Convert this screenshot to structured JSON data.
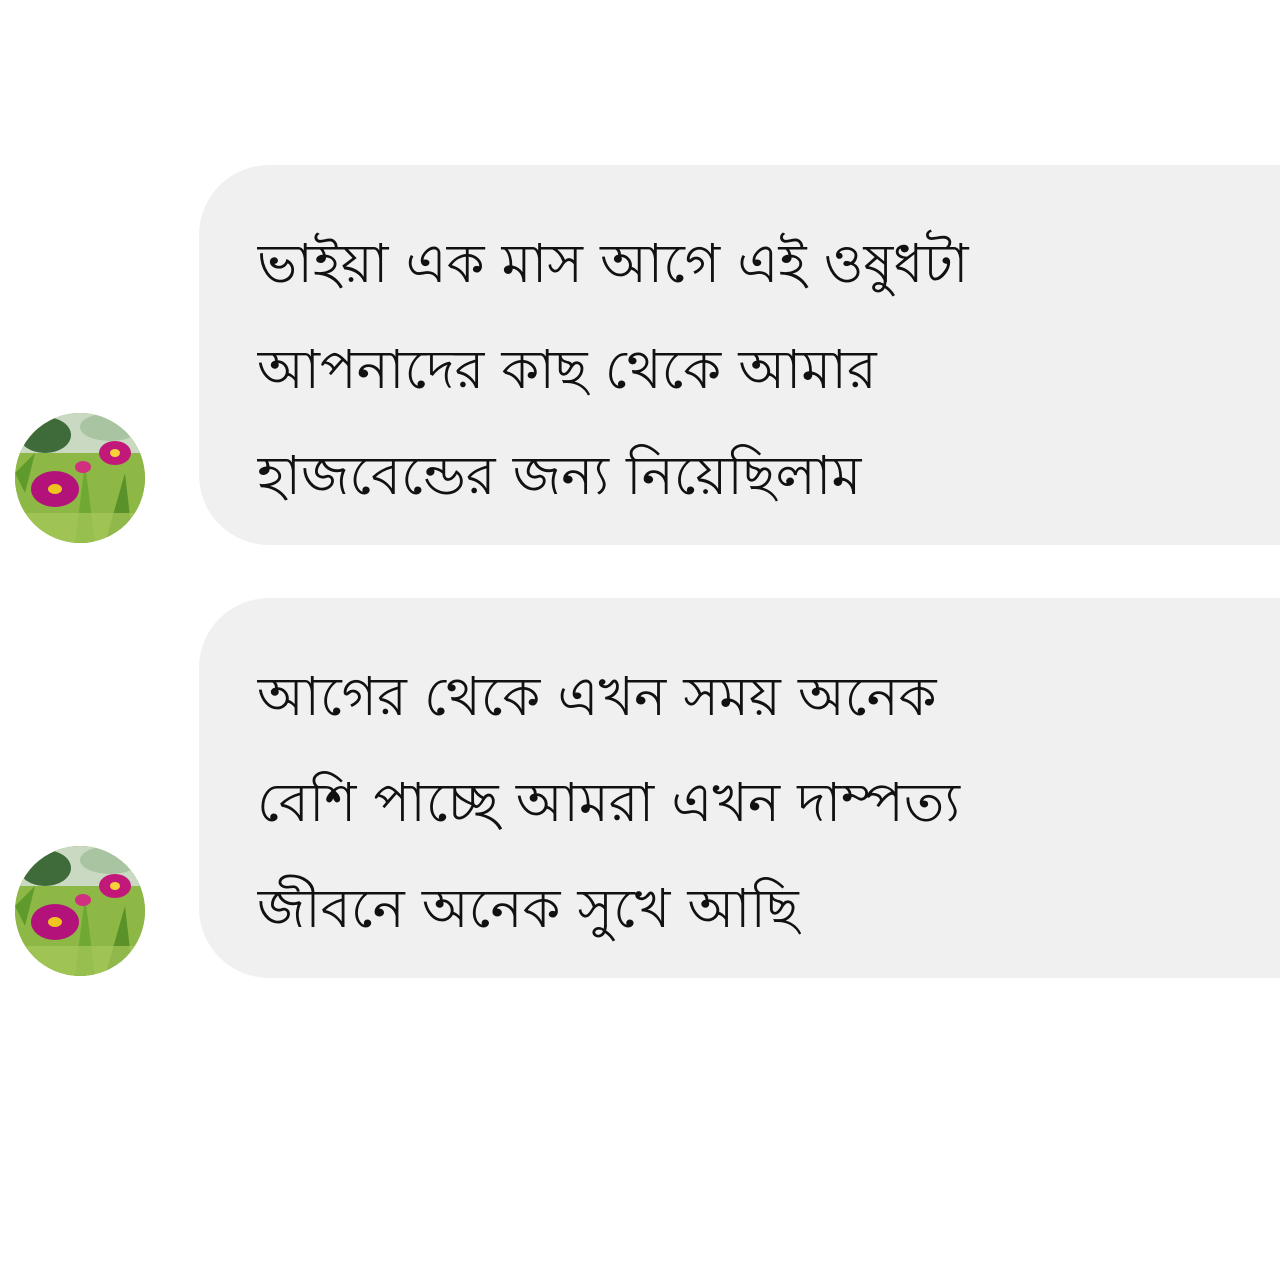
{
  "messages": [
    {
      "avatar_icon": "flower-avatar-icon",
      "lines": [
        "ভাইয়া এক মাস  আগে এই ওষুধটা",
        "আপনাদের কাছ থেকে আমার",
        "হাজবেন্ডের জন্য নিয়েছিলাম"
      ]
    },
    {
      "avatar_icon": "flower-avatar-icon",
      "lines": [
        "আগের থেকে এখন সময় অনেক",
        "বেশি পাচ্ছে আমরা এখন দাম্পত্য",
        "জীবনে অনেক সুখে আছি"
      ]
    }
  ],
  "colors": {
    "bubble_background": "#f0f0f0",
    "text": "#111111",
    "page_background": "#ffffff"
  }
}
